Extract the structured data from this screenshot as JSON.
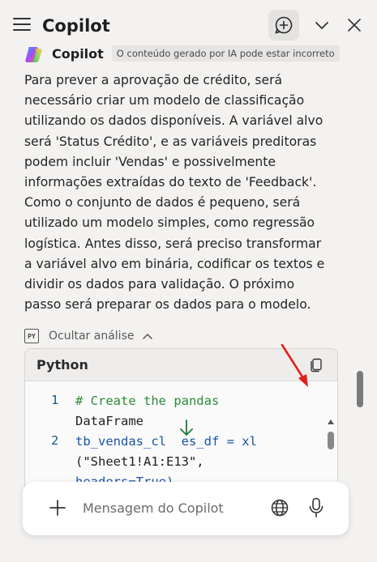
{
  "header": {
    "title": "Copilot",
    "icons": [
      "menu-icon",
      "new-chat-icon",
      "chevron-down-icon",
      "close-icon"
    ]
  },
  "agent": {
    "name": "Copilot",
    "disclaimer": "O conteúdo gerado por IA pode estar incorreto"
  },
  "message": {
    "text": "Para prever a aprovação de crédito, será necessário criar um modelo de classificação utilizando os dados disponíveis. A variável alvo será 'Status Crédito', e as variáveis preditoras podem incluir 'Vendas' e possivelmente informações extraídas do texto de 'Feedback'. Como o conjunto de dados é pequeno, será utilizado um modelo simples, como regressão logística. Antes disso, será preciso transformar a variável alvo em binária, codificar os textos e dividir os dados para validação. O próximo passo será preparar os dados para o modelo."
  },
  "analysis": {
    "icon_label": "PY",
    "toggle_label": "Ocultar análise"
  },
  "code_block": {
    "language": "Python",
    "lines": [
      {
        "number": "1",
        "rows": [
          "# Create the pandas",
          "DataFrame"
        ]
      },
      {
        "number": "2",
        "rows": [
          "tb_vendas_cl  es_df = xl",
          "(\"Sheet1!A1:E13\",",
          "headers=True)"
        ]
      }
    ]
  },
  "input": {
    "placeholder": "Mensagem do Copilot"
  },
  "colors": {
    "accent_annotation": "#e0201b",
    "comment": "#2e8b3a",
    "line_number": "#1a5a8a"
  }
}
